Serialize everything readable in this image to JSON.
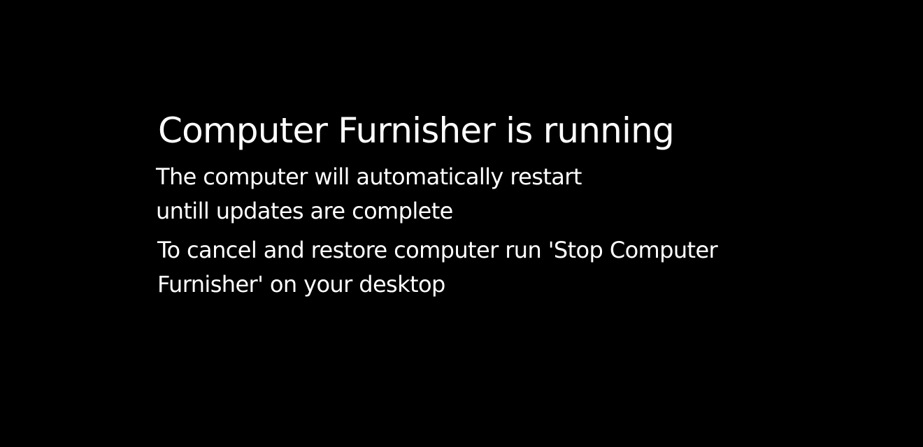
{
  "screen": {
    "background_color": "#000000",
    "text_color": "#ffffff",
    "title": "Computer Furnisher is running",
    "lines": [
      "The computer will automatically restart",
      "untill updates are complete",
      "To cancel and restore computer run 'Stop Computer",
      "Furnisher' on your desktop"
    ]
  }
}
